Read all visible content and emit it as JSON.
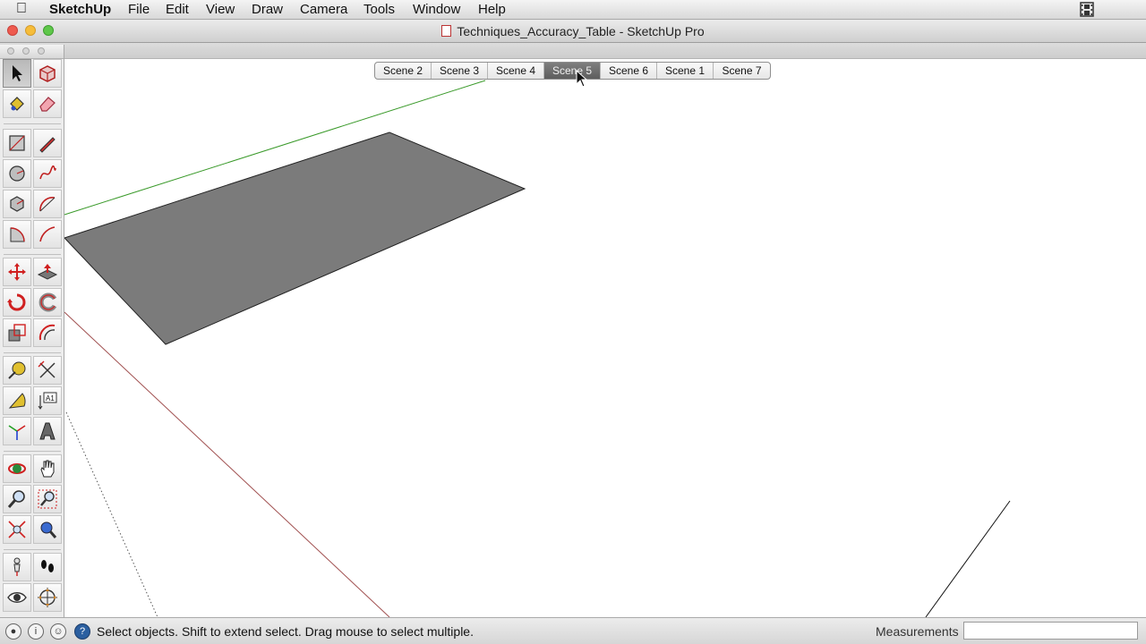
{
  "menubar": {
    "app_name": "SketchUp",
    "items": [
      "File",
      "Edit",
      "View",
      "Draw",
      "Camera",
      "Tools",
      "Window",
      "Help"
    ]
  },
  "window": {
    "title": "Techniques_Accuracy_Table - SketchUp Pro"
  },
  "scenes": {
    "tabs": [
      "Scene 2",
      "Scene 3",
      "Scene 4",
      "Scene 5",
      "Scene 6",
      "Scene 1",
      "Scene 7"
    ],
    "active": "Scene 5"
  },
  "tools": [
    {
      "name": "select-tool-icon",
      "selected": true
    },
    {
      "name": "make-component-icon"
    },
    {
      "name": "paint-bucket-icon"
    },
    {
      "name": "eraser-icon"
    },
    {
      "name": "rectangle-icon"
    },
    {
      "name": "line-icon"
    },
    {
      "name": "circle-icon"
    },
    {
      "name": "freehand-icon"
    },
    {
      "name": "polygon-icon"
    },
    {
      "name": "arc-icon"
    },
    {
      "name": "pie-icon"
    },
    {
      "name": "two-point-arc-icon"
    },
    {
      "name": "move-icon"
    },
    {
      "name": "push-pull-icon"
    },
    {
      "name": "rotate-icon"
    },
    {
      "name": "follow-me-icon"
    },
    {
      "name": "scale-icon"
    },
    {
      "name": "offset-icon"
    },
    {
      "name": "tape-measure-icon"
    },
    {
      "name": "dimension-icon"
    },
    {
      "name": "protractor-icon"
    },
    {
      "name": "text-icon"
    },
    {
      "name": "axes-icon"
    },
    {
      "name": "3d-text-icon"
    },
    {
      "name": "orbit-icon"
    },
    {
      "name": "pan-icon"
    },
    {
      "name": "zoom-icon"
    },
    {
      "name": "zoom-window-icon"
    },
    {
      "name": "zoom-extents-icon"
    },
    {
      "name": "previous-view-icon"
    },
    {
      "name": "position-camera-icon"
    },
    {
      "name": "walk-icon"
    },
    {
      "name": "look-around-icon"
    },
    {
      "name": "section-plane-icon"
    }
  ],
  "tool_labels": {
    "text_glyph": "A1"
  },
  "statusbar": {
    "message": "Select objects. Shift to extend select. Drag mouse to select multiple.",
    "measurements_label": "Measurements",
    "measurements_value": "",
    "help_glyph": "?"
  },
  "colors": {
    "face": "#7b7b7b",
    "green_axis": "#3a9a2a",
    "red_axis": "#a05050",
    "active_tab": "#6b6b6b"
  }
}
